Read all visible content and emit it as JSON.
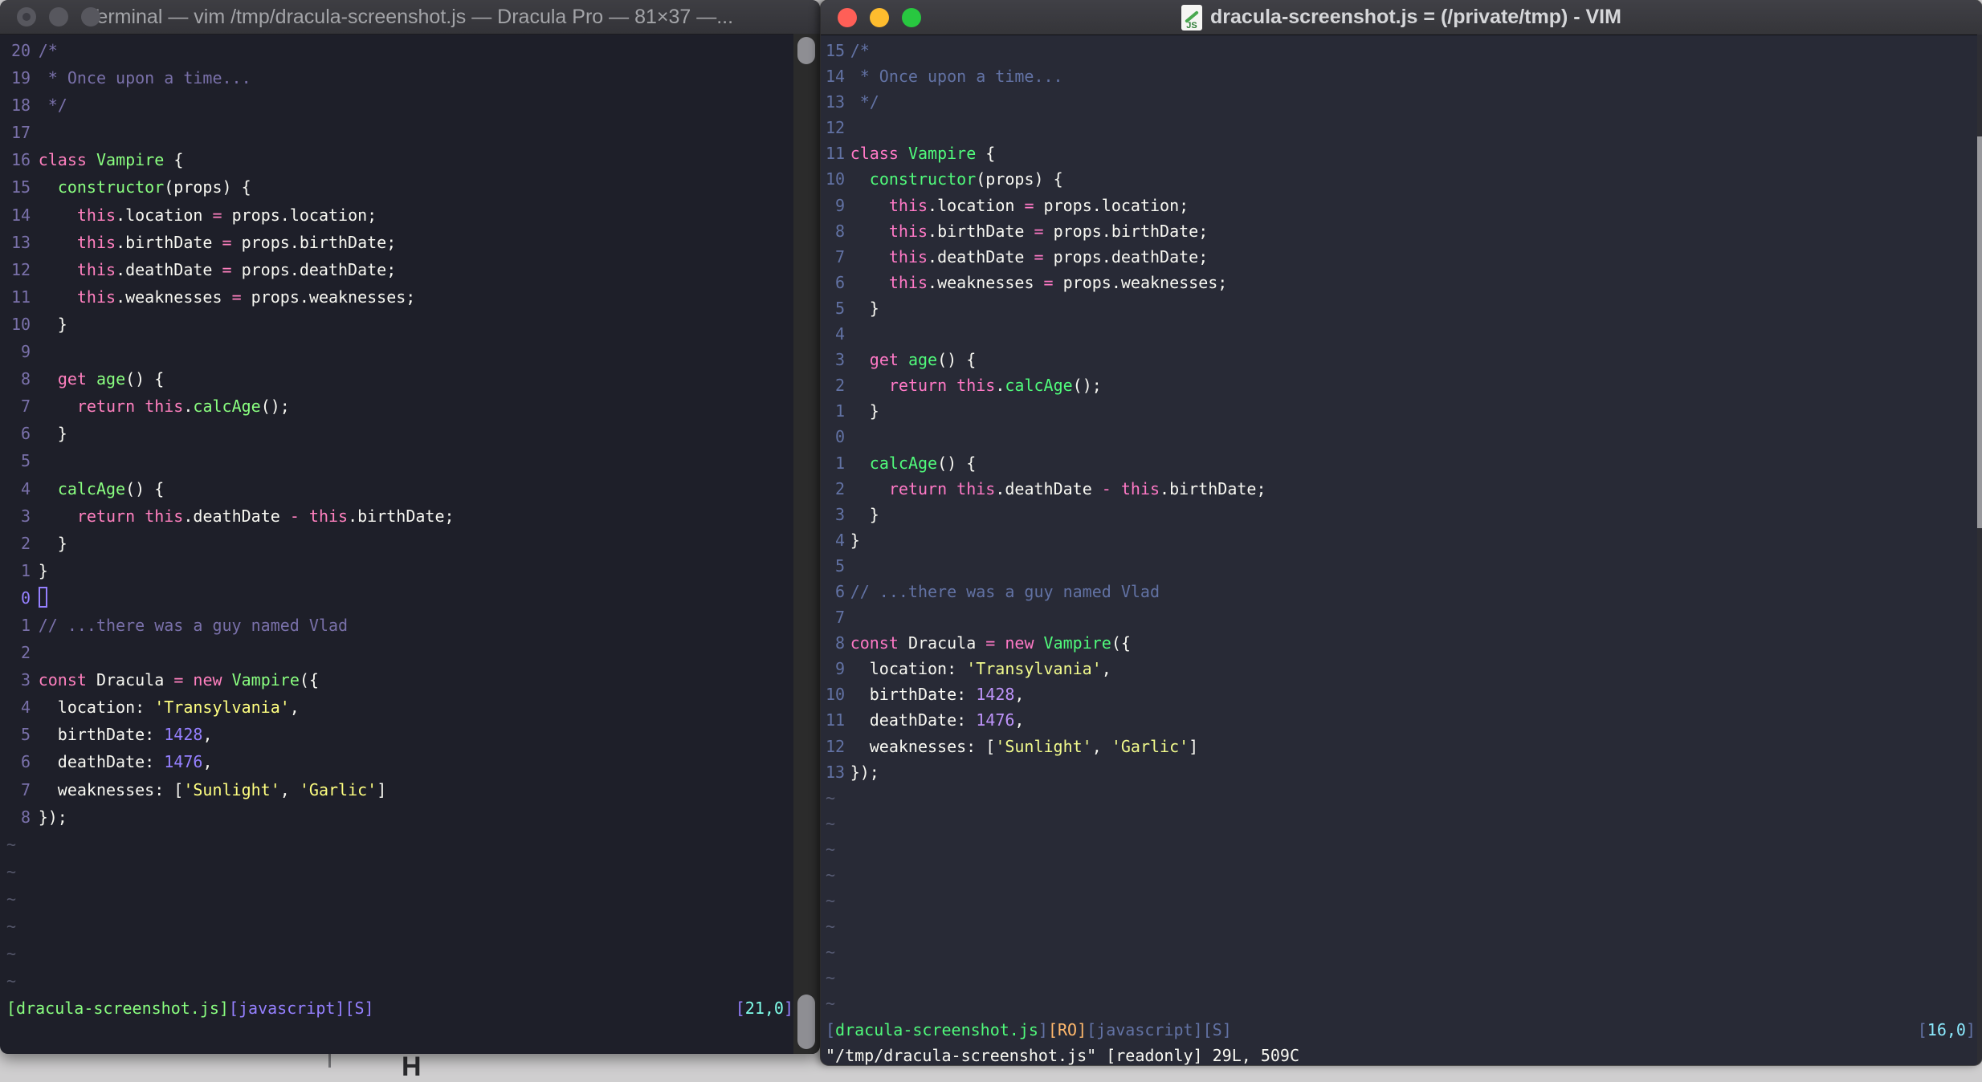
{
  "desktop": {
    "background_letter": "H"
  },
  "code_lines": [
    [
      [
        "c",
        "/*"
      ]
    ],
    [
      [
        "c",
        " * Once upon a time..."
      ]
    ],
    [
      [
        "c",
        " */"
      ]
    ],
    [],
    [
      [
        "p",
        "class"
      ],
      [
        "f",
        " "
      ],
      [
        "g",
        "Vampire"
      ],
      [
        "f",
        " {"
      ]
    ],
    [
      [
        "f",
        "  "
      ],
      [
        "g",
        "constructor"
      ],
      [
        "f",
        "(props) {"
      ]
    ],
    [
      [
        "f",
        "    "
      ],
      [
        "p",
        "this"
      ],
      [
        "f",
        ".location "
      ],
      [
        "p",
        "="
      ],
      [
        "f",
        " props.location;"
      ]
    ],
    [
      [
        "f",
        "    "
      ],
      [
        "p",
        "this"
      ],
      [
        "f",
        ".birthDate "
      ],
      [
        "p",
        "="
      ],
      [
        "f",
        " props.birthDate;"
      ]
    ],
    [
      [
        "f",
        "    "
      ],
      [
        "p",
        "this"
      ],
      [
        "f",
        ".deathDate "
      ],
      [
        "p",
        "="
      ],
      [
        "f",
        " props.deathDate;"
      ]
    ],
    [
      [
        "f",
        "    "
      ],
      [
        "p",
        "this"
      ],
      [
        "f",
        ".weaknesses "
      ],
      [
        "p",
        "="
      ],
      [
        "f",
        " props.weaknesses;"
      ]
    ],
    [
      [
        "f",
        "  }"
      ]
    ],
    [],
    [
      [
        "f",
        "  "
      ],
      [
        "p",
        "get"
      ],
      [
        "f",
        " "
      ],
      [
        "g",
        "age"
      ],
      [
        "f",
        "() {"
      ]
    ],
    [
      [
        "f",
        "    "
      ],
      [
        "p",
        "return"
      ],
      [
        "f",
        " "
      ],
      [
        "p",
        "this"
      ],
      [
        "f",
        "."
      ],
      [
        "g",
        "calcAge"
      ],
      [
        "f",
        "();"
      ]
    ],
    [
      [
        "f",
        "  }"
      ]
    ],
    [],
    [
      [
        "f",
        "  "
      ],
      [
        "g",
        "calcAge"
      ],
      [
        "f",
        "() {"
      ]
    ],
    [
      [
        "f",
        "    "
      ],
      [
        "p",
        "return"
      ],
      [
        "f",
        " "
      ],
      [
        "p",
        "this"
      ],
      [
        "f",
        ".deathDate "
      ],
      [
        "p",
        "-"
      ],
      [
        "f",
        " "
      ],
      [
        "p",
        "this"
      ],
      [
        "f",
        ".birthDate;"
      ]
    ],
    [
      [
        "f",
        "  }"
      ]
    ],
    [
      [
        "f",
        "}"
      ]
    ],
    [],
    [
      [
        "c",
        "// ...there was a guy named Vlad"
      ]
    ],
    [],
    [
      [
        "p",
        "const"
      ],
      [
        "f",
        " Dracula "
      ],
      [
        "p",
        "="
      ],
      [
        "f",
        " "
      ],
      [
        "p",
        "new"
      ],
      [
        "f",
        " "
      ],
      [
        "g",
        "Vampire"
      ],
      [
        "f",
        "({"
      ]
    ],
    [
      [
        "f",
        "  location: "
      ],
      [
        "y",
        "'Transylvania'"
      ],
      [
        "f",
        ","
      ]
    ],
    [
      [
        "f",
        "  birthDate: "
      ],
      [
        "n",
        "1428"
      ],
      [
        "f",
        ","
      ]
    ],
    [
      [
        "f",
        "  deathDate: "
      ],
      [
        "n",
        "1476"
      ],
      [
        "f",
        ","
      ]
    ],
    [
      [
        "f",
        "  weaknesses: ["
      ],
      [
        "y",
        "'Sunlight'"
      ],
      [
        "f",
        ", "
      ],
      [
        "y",
        "'Garlic'"
      ],
      [
        "f",
        "]"
      ]
    ],
    [
      [
        "f",
        "});"
      ]
    ]
  ],
  "left_window": {
    "title": "Terminal — vim /tmp/dracula-screenshot.js — Dracula Pro — 81×37 —...",
    "geometry_label": "81×37",
    "line_numbers": [
      20,
      19,
      18,
      17,
      16,
      15,
      14,
      13,
      12,
      11,
      10,
      9,
      8,
      7,
      6,
      5,
      4,
      3,
      2,
      1,
      0,
      1,
      2,
      3,
      4,
      5,
      6,
      7,
      8
    ],
    "cursor_row": 20,
    "show_hollow_cursor": true,
    "tilde_count": 6,
    "status_segments": [
      [
        "g",
        "[dracula-screenshot.js]"
      ],
      [
        "s",
        "[javascript][S]"
      ]
    ],
    "status_position": [
      [
        "s",
        "["
      ],
      [
        "cy",
        "21,0"
      ],
      [
        "s",
        "]"
      ]
    ],
    "command_line": "",
    "palette": {
      "bg": "#1E1F29",
      "fg": "#F8F8F2",
      "comment": "#7970A9",
      "linenr": "#7970A9",
      "linenr_cursor": "#9580FF",
      "pink": "#FF80BF",
      "green": "#8AFF80",
      "yellow": "#FFFF80",
      "purple": "#9580FF",
      "cyan": "#80FFEA",
      "secondary": "#9580FF",
      "orange": "#FFB86C",
      "tilde": "#54566A"
    },
    "chrome": {
      "titlebar_text": "#A3A4A8",
      "light_inactive": "#57575E"
    }
  },
  "right_window": {
    "title": "dracula-screenshot.js = (/private/tmp) - VIM",
    "doc_icon_label": "JS",
    "line_numbers": [
      15,
      14,
      13,
      12,
      11,
      10,
      9,
      8,
      7,
      6,
      5,
      4,
      3,
      2,
      1,
      0,
      1,
      2,
      3,
      4,
      5,
      6,
      7,
      8,
      9,
      10,
      11,
      12,
      13
    ],
    "cursor_row": 15,
    "show_hollow_cursor": false,
    "tilde_count": 9,
    "status_segments": [
      [
        "s",
        "["
      ],
      [
        "g",
        "dracula-screenshot.js"
      ],
      [
        "s",
        "]"
      ],
      [
        "o",
        "[RO]"
      ],
      [
        "s",
        "[javascript][S]"
      ]
    ],
    "status_position": [
      [
        "s",
        "["
      ],
      [
        "cy",
        "16,0"
      ],
      [
        "s",
        "]"
      ]
    ],
    "command_line": "\"/tmp/dracula-screenshot.js\" [readonly] 29L, 509C",
    "palette": {
      "bg": "#282A36",
      "fg": "#F8F8F2",
      "comment": "#6272A4",
      "linenr": "#6272A4",
      "linenr_cursor": "#6272A4",
      "pink": "#FF79C6",
      "green": "#50FA7B",
      "yellow": "#F1FA8C",
      "purple": "#BD93F9",
      "cyan": "#8BE9FD",
      "secondary": "#6272A4",
      "orange": "#FFB86C",
      "tilde": "#565B73"
    },
    "chrome": {
      "titlebar_text": "#D5D6D9",
      "light_close": "#FF5F57",
      "light_minimize": "#FEBC2E",
      "light_zoom": "#28C840"
    }
  }
}
